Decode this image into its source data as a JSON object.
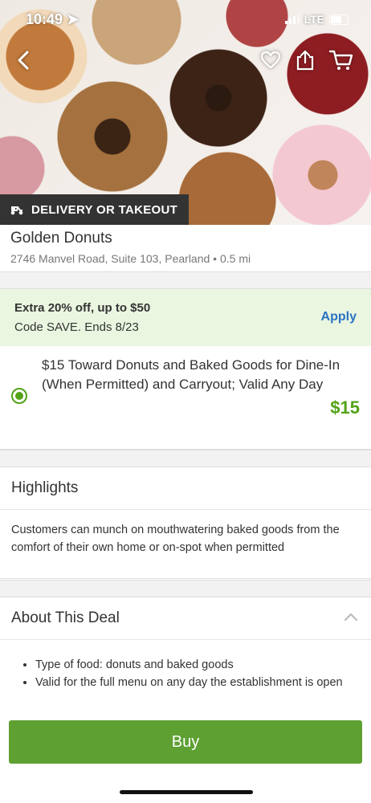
{
  "status_bar": {
    "time": "10:49",
    "network": "LTE"
  },
  "hero": {
    "badge": "DELIVERY OR TAKEOUT"
  },
  "merchant": {
    "name": "Golden Donuts",
    "address": "2746 Manvel Road, Suite 103, Pearland • 0.5 mi"
  },
  "promo": {
    "headline": "Extra 20% off, up to $50",
    "code_line": "Code SAVE. Ends 8/23",
    "apply_label": "Apply"
  },
  "option": {
    "title": "$15 Toward Donuts and Baked Goods for Dine-In (When Permitted) and Carryout; Valid Any Day",
    "price": "$15",
    "selected": true
  },
  "highlights": {
    "heading": "Highlights",
    "text": "Customers can munch on mouthwatering baked goods from the comfort of their own home or on-spot when permitted"
  },
  "about": {
    "heading": "About This Deal",
    "bullets": [
      "Type of food: donuts and baked goods",
      "Valid for the full menu on any day the establishment is open"
    ]
  },
  "buy_label": "Buy",
  "icons": [
    "location-arrow-icon",
    "signal-icon",
    "battery-icon",
    "back-icon",
    "heart-icon",
    "share-icon",
    "cart-icon",
    "scooter-icon",
    "chevron-up-icon"
  ],
  "colors": {
    "accent_green": "#53a318",
    "buy_green": "#5fa033",
    "link_blue": "#2a72c4",
    "promo_bg": "#eaf6e0"
  }
}
